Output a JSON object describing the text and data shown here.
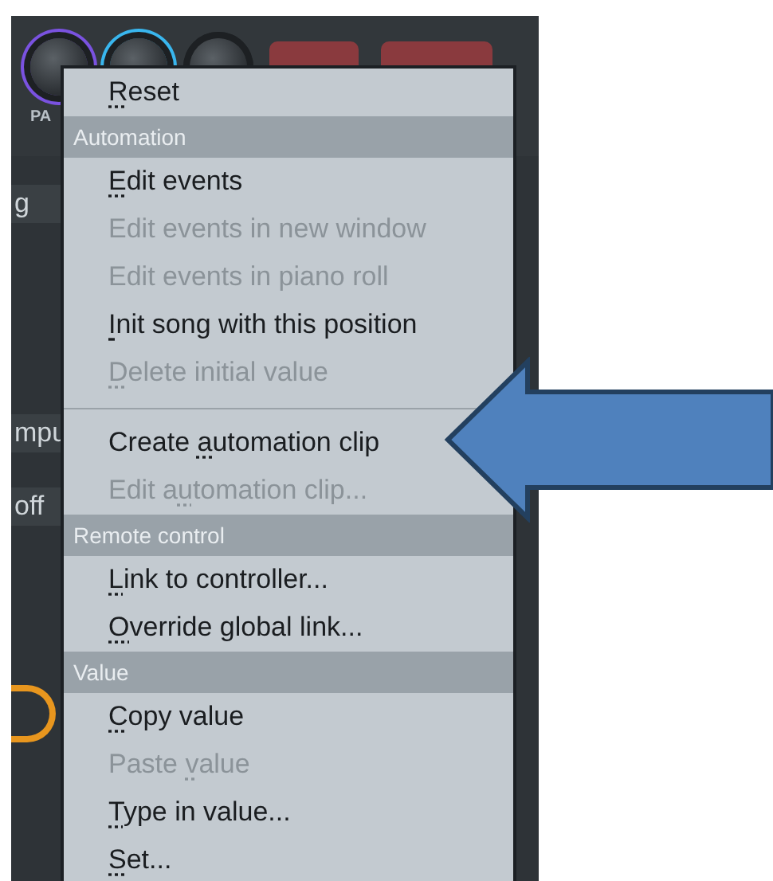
{
  "background": {
    "knob_label": "PA",
    "side_texts": [
      "g",
      "mpu",
      "off"
    ]
  },
  "menu": {
    "entries": [
      {
        "kind": "item",
        "key": "R",
        "post": "eset",
        "disabled": false
      },
      {
        "kind": "header",
        "label": "Automation"
      },
      {
        "kind": "item",
        "key": "E",
        "post": "dit events",
        "disabled": false
      },
      {
        "kind": "item",
        "pre": "Edit events in new window",
        "disabled": true
      },
      {
        "kind": "item",
        "pre": "Edit events in piano roll",
        "disabled": true
      },
      {
        "kind": "item",
        "key": "I",
        "post": "nit song with this position",
        "disabled": false
      },
      {
        "kind": "item",
        "key": "D",
        "post": "elete initial value",
        "disabled": true
      },
      {
        "kind": "separator"
      },
      {
        "kind": "item",
        "pre": "Create ",
        "key": "a",
        "post": "utomation clip",
        "disabled": false
      },
      {
        "kind": "item",
        "pre": "Edit a",
        "key": "u",
        "post": "tomation clip...",
        "disabled": true
      },
      {
        "kind": "header",
        "label": "Remote control"
      },
      {
        "kind": "item",
        "key": "L",
        "post": "ink to controller...",
        "disabled": false
      },
      {
        "kind": "item",
        "key": "O",
        "post": "verride global link...",
        "disabled": false
      },
      {
        "kind": "header",
        "label": "Value"
      },
      {
        "kind": "item",
        "key": "C",
        "post": "opy value",
        "disabled": false
      },
      {
        "kind": "item",
        "pre": "Paste ",
        "key": "v",
        "post": "alue",
        "disabled": true
      },
      {
        "kind": "item",
        "key": "T",
        "post": "ype in value...",
        "disabled": false
      },
      {
        "kind": "item",
        "key": "S",
        "post": "et...",
        "disabled": false
      }
    ]
  }
}
